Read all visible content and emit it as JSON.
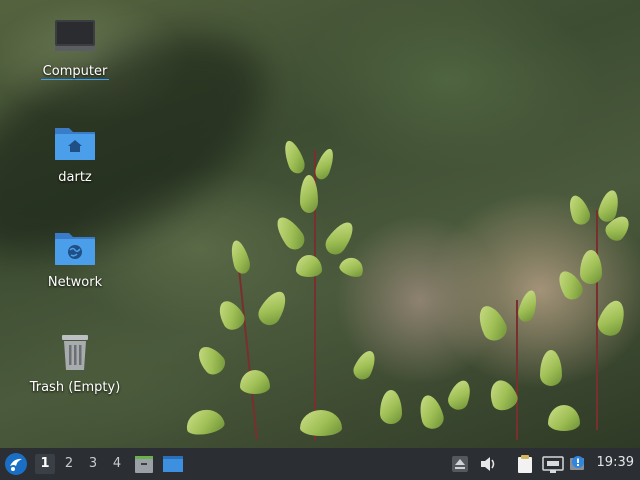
{
  "desktop": {
    "icons": [
      {
        "label": "Computer",
        "icon": "computer-icon",
        "selected": true
      },
      {
        "label": "dartz",
        "icon": "home-folder-icon"
      },
      {
        "label": "Network",
        "icon": "network-folder-icon"
      },
      {
        "label": "Trash (Empty)",
        "icon": "trash-icon"
      }
    ]
  },
  "panel": {
    "workspaces": [
      "1",
      "2",
      "3",
      "4"
    ],
    "active_workspace": "1",
    "clock": "19:39",
    "colors": {
      "background": "#2b2e33",
      "accent": "#4a9eea"
    }
  }
}
